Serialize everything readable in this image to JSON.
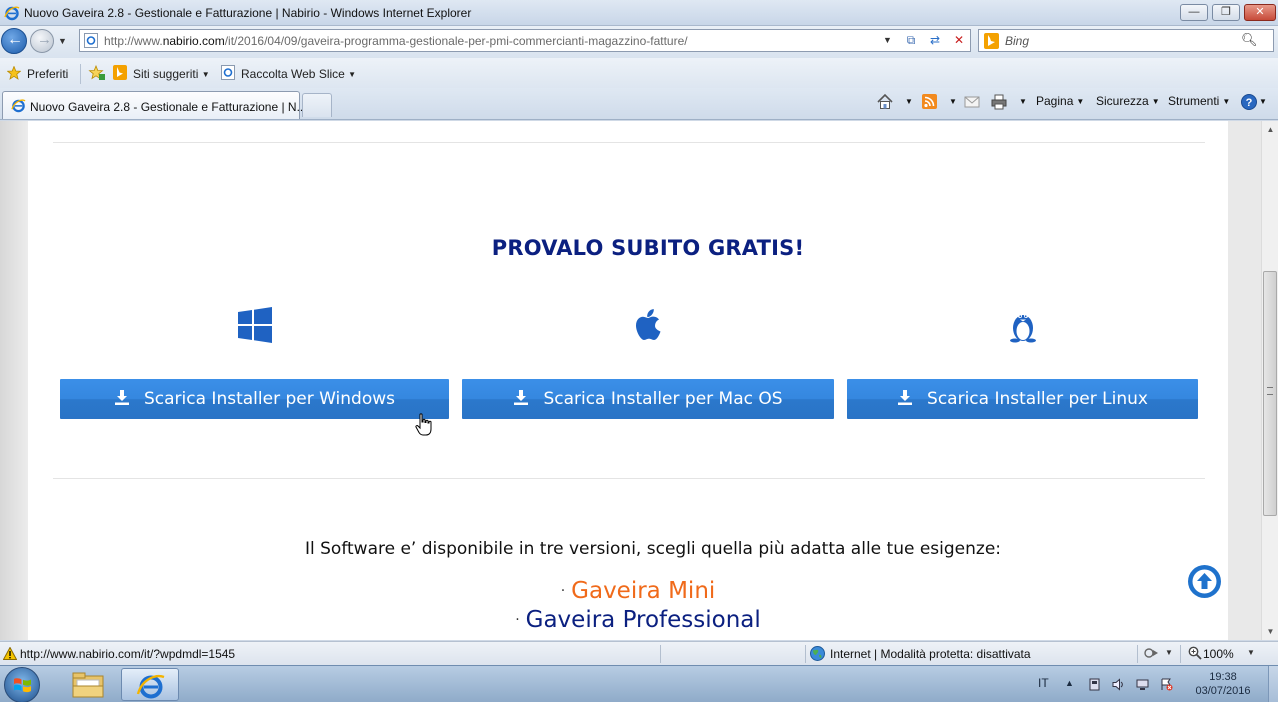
{
  "window": {
    "title": "Nuovo Gaveira 2.8 - Gestionale e Fatturazione | Nabirio - Windows Internet Explorer",
    "min_label": "—",
    "max_label": "❐",
    "close_label": "✕"
  },
  "nav": {
    "url_prefix": "http://www.",
    "url_domain": "nabirio.com",
    "url_rest": "/it/2016/04/09/gaveira-programma-gestionale-per-pmi-commercianti-magazzino-fatture/",
    "search_placeholder": "Bing"
  },
  "favorites": {
    "label": "Preferiti",
    "siti_suggeriti": "Siti suggeriti",
    "raccolta": "Raccolta Web Slice"
  },
  "tabs": [
    {
      "title": "Nuovo Gaveira 2.8 - Gestionale e Fatturazione | N..."
    }
  ],
  "commands": {
    "pagina": "Pagina",
    "sicurezza": "Sicurezza",
    "strumenti": "Strumenti"
  },
  "content": {
    "headline": "PROVALO SUBITO GRATIS!",
    "buttons": {
      "windows": "Scarica Installer per Windows",
      "mac": "Scarica Installer per Mac OS",
      "linux": "Scarica Installer per Linux"
    },
    "versions_intro": "Il Software e’ disponibile in tre versioni, scegli quella più adatta alle tue esigenze:",
    "versions": {
      "bullet": "·",
      "mini": "Gaveira Mini",
      "pro": "Gaveira Professional"
    }
  },
  "status": {
    "url": "http://www.nabirio.com/it/?wpdmdl=1545",
    "zone": "Internet | Modalità protetta: disattivata",
    "zoom": "100%"
  },
  "taskbar": {
    "lang": "IT",
    "time": "19:38",
    "date": "03/07/2016"
  },
  "colors": {
    "headline": "#0b2080",
    "button": "#3587df",
    "mini": "#f06a1a",
    "pro": "#0b2080"
  },
  "icons": [
    "ie-icon",
    "back-icon",
    "forward-icon",
    "compat-view-icon",
    "refresh-icon",
    "stop-icon",
    "bing-icon",
    "search-icon",
    "favorites-star-icon",
    "home-icon",
    "rss-icon",
    "mail-icon",
    "print-icon",
    "help-icon",
    "windows-logo-icon",
    "apple-logo-icon",
    "linux-tux-icon",
    "download-icon",
    "scroll-to-top-icon",
    "globe-icon",
    "zoom-icon"
  ]
}
